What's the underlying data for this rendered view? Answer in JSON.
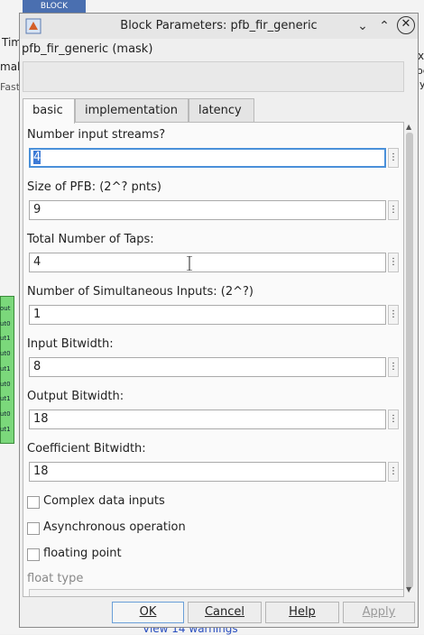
{
  "window": {
    "title": "Block Parameters: pfb_fir_generic",
    "controls": [
      "chevron-down",
      "chevron-up",
      "close"
    ]
  },
  "mask_label": "pfb_fir_generic (mask)",
  "tabs": [
    {
      "label": "basic",
      "active": true
    },
    {
      "label": "implementation",
      "active": false
    },
    {
      "label": "latency",
      "active": false
    }
  ],
  "fields": [
    {
      "label": "Number input streams?",
      "value": "4"
    },
    {
      "label": "Size of PFB: (2^? pnts)",
      "value": "9"
    },
    {
      "label": "Total Number of Taps:",
      "value": "4"
    },
    {
      "label": "Number of Simultaneous Inputs: (2^?)",
      "value": "1"
    },
    {
      "label": "Input Bitwidth:",
      "value": "8"
    },
    {
      "label": "Output Bitwidth:",
      "value": "18"
    },
    {
      "label": "Coefficient Bitwidth:",
      "value": "18"
    }
  ],
  "checkboxes": [
    {
      "label": "Complex data inputs",
      "checked": false
    },
    {
      "label": "Asynchronous operation",
      "checked": false
    },
    {
      "label": "floating point",
      "checked": false
    }
  ],
  "float_type_label": "float type",
  "buttons": {
    "ok": "OK",
    "cancel": "Cancel",
    "help": "Help",
    "apply": "Apply"
  },
  "background": {
    "tab_text": "BLOCK",
    "left_labels": [
      "Tim",
      "mal",
      "Fast"
    ],
    "right_labels": [
      "x",
      "oc",
      "ly"
    ],
    "ports": [
      "out",
      "ut0",
      "ut1",
      "ut0",
      "ut1",
      "ut0",
      "ut1",
      "ut0",
      "ut1"
    ],
    "warnings": "View 14 warnings"
  },
  "colors": {
    "selection": "#3d7bd6",
    "focus_border": "#4a90d9",
    "block_green": "#7bd87b"
  }
}
